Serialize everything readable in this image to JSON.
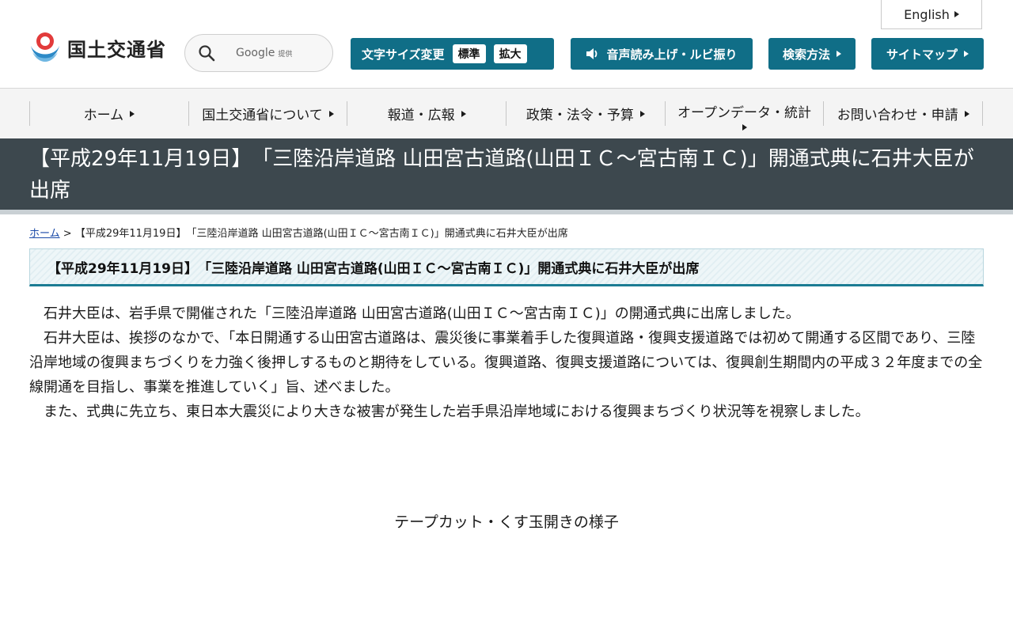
{
  "header": {
    "english_label": "English",
    "logo_text": "国土交通省",
    "search": {
      "brand": "Google",
      "brand_suffix": "提供"
    },
    "font_size": {
      "label": "文字サイズ変更",
      "standard": "標準",
      "large": "拡大"
    },
    "voice_label": "音声読み上げ・ルビ振り",
    "search_method_label": "検索方法",
    "sitemap_label": "サイトマップ"
  },
  "nav": {
    "items": [
      {
        "label": "ホーム"
      },
      {
        "label": "国土交通省について"
      },
      {
        "label": "報道・広報"
      },
      {
        "label": "政策・法令・予算"
      },
      {
        "label": "オープンデータ・統計"
      },
      {
        "label": "お問い合わせ・申請"
      }
    ]
  },
  "page": {
    "title": "【平成29年11月19日】　「三陸沿岸道路 山田宮古道路(山田ＩＣ～宮古南ＩＣ)」開通式典に石井大臣が出席",
    "breadcrumb": {
      "home": "ホーム",
      "separator": ">",
      "current": "【平成29年11月19日】　「三陸沿岸道路 山田宮古道路(山田ＩＣ～宮古南ＩＣ)」開通式典に石井大臣が出席"
    },
    "heading": "【平成29年11月19日】　「三陸沿岸道路 山田宮古道路(山田ＩＣ～宮古南ＩＣ)」開通式典に石井大臣が出席",
    "paragraphs": [
      "石井大臣は、岩手県で開催された「三陸沿岸道路 山田宮古道路(山田ＩＣ～宮古南ＩＣ)」の開通式典に出席しました。",
      "石井大臣は、挨拶のなかで、「本日開通する山田宮古道路は、震災後に事業着手した復興道路・復興支援道路では初めて開通する区間であり、三陸沿岸地域の復興まちづくりを力強く後押しするものと期待をしている。復興道路、復興支援道路については、復興創生期間内の平成３２年度までの全線開通を目指し、事業を推進していく」旨、述べました。",
      "また、式典に先立ち、東日本大震災により大きな被害が発生した岩手県沿岸地域における復興まちづくり状況等を視察しました。"
    ],
    "caption": "テープカット・くす玉開きの様子"
  },
  "colors": {
    "accent": "#106e87",
    "title_band": "#3d484e"
  }
}
